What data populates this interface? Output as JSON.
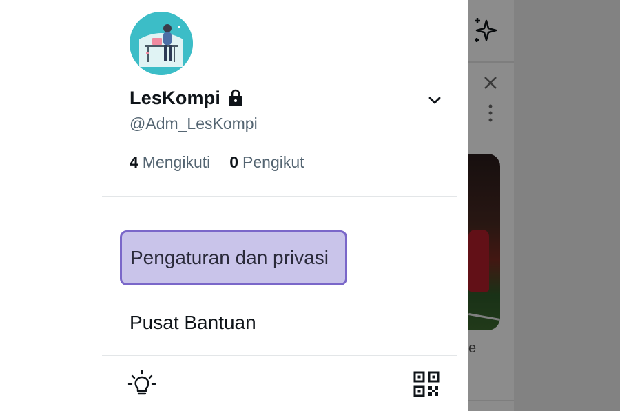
{
  "profile": {
    "display_name": "LesKompi",
    "handle": "@Adm_LesKompi",
    "following_count": "4",
    "following_label": "Mengikuti",
    "followers_count": "0",
    "followers_label": "Pengikut"
  },
  "menu": {
    "settings_label": "Pengaturan dan privasi",
    "help_label": "Pusat Bantuan"
  },
  "background": {
    "stray_letter": "e"
  },
  "colors": {
    "highlight_fill": "#c9c4ea",
    "highlight_border": "#7a67c9",
    "avatar_bg": "#3cbdc7",
    "secondary_text": "#536471"
  },
  "icons": {
    "lock": "lock-icon",
    "chevron": "chevron-down-icon",
    "bulb": "lightbulb-icon",
    "qr": "qr-code-icon",
    "sparkle": "sparkle-icon",
    "close": "close-icon",
    "more": "more-vertical-icon"
  }
}
